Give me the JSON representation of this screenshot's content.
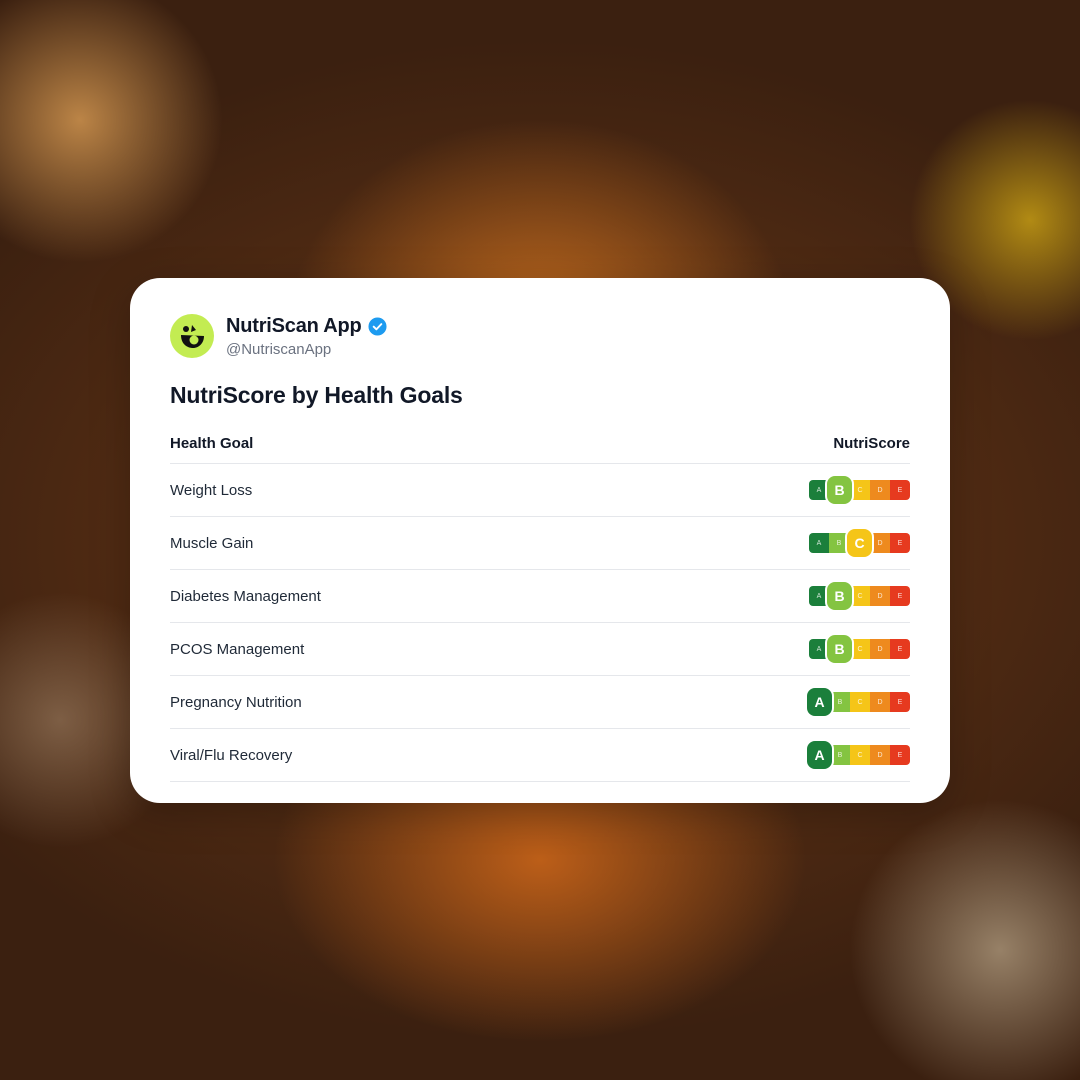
{
  "account": {
    "name": "NutriScan App",
    "handle": "@NutriscanApp",
    "avatar_icon": "nutriscan-logo-icon",
    "verified_icon": "verified-badge-icon",
    "brand_color": "#c3ec52",
    "verified_color": "#1d9bf0"
  },
  "post": {
    "title": "NutriScore by Health Goals"
  },
  "table": {
    "headers": {
      "goal": "Health Goal",
      "score": "NutriScore"
    },
    "grades": [
      "A",
      "B",
      "C",
      "D",
      "E"
    ],
    "grade_colors": {
      "A": "#1b7f3b",
      "B": "#84c441",
      "C": "#f5c518",
      "D": "#ee8a1e",
      "E": "#e63a1f"
    },
    "rows": [
      {
        "goal": "Weight Loss",
        "score": "B"
      },
      {
        "goal": "Muscle Gain",
        "score": "C"
      },
      {
        "goal": "Diabetes Management",
        "score": "B"
      },
      {
        "goal": "PCOS Management",
        "score": "B"
      },
      {
        "goal": "Pregnancy Nutrition",
        "score": "A"
      },
      {
        "goal": "Viral/Flu Recovery",
        "score": "A"
      }
    ]
  }
}
